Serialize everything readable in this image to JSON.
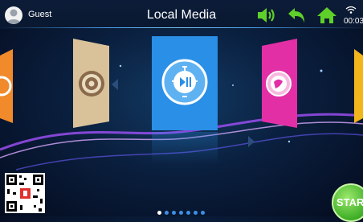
{
  "header": {
    "user_name": "Guest",
    "title": "Local Media",
    "clock": "00:03"
  },
  "icons": {
    "avatar": "user-avatar-icon",
    "volume": "speaker-icon",
    "back": "back-arrow-icon",
    "home": "home-icon",
    "wifi": "wifi-icon"
  },
  "carousel": {
    "items": [
      "settings-app",
      "media-player-app",
      "browser-app"
    ],
    "page_count": 7,
    "active_page": 1
  },
  "start_button": {
    "label": "START"
  },
  "colors": {
    "accent_green": "#5fd02a",
    "media_card": "#2a8fe6",
    "settings_card": "#d9c29a",
    "browser_card": "#e22fa6",
    "left_card": "#f08a2a",
    "right_card": "#f2b51c"
  }
}
